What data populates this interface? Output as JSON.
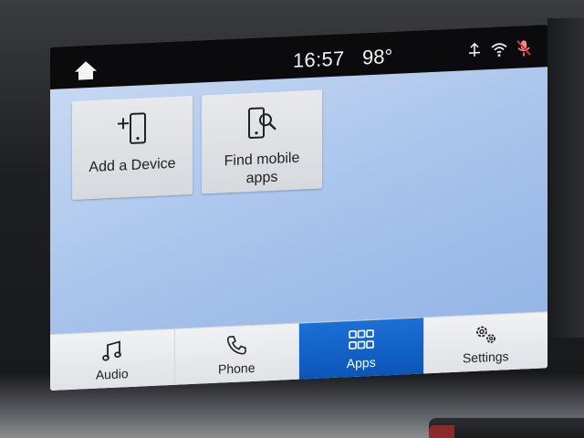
{
  "status_bar": {
    "time": "16:57",
    "temperature": "98°",
    "icons": [
      "home-icon",
      "navigation-arrows-icon",
      "wifi-icon",
      "mic-muted-icon"
    ]
  },
  "tiles": [
    {
      "label": "Add a Device",
      "icon": "add-device-icon"
    },
    {
      "label": "Find mobile apps",
      "icon": "find-apps-icon"
    }
  ],
  "nav": {
    "items": [
      {
        "label": "Audio",
        "icon": "music-note-icon"
      },
      {
        "label": "Phone",
        "icon": "phone-icon"
      },
      {
        "label": "Apps",
        "icon": "apps-grid-icon",
        "active": true
      },
      {
        "label": "Settings",
        "icon": "gears-icon"
      }
    ]
  },
  "colors": {
    "active_tab": "#0b55b8",
    "content_bg": "#a9c4ec",
    "status_bar_bg": "#0b0b0d"
  }
}
